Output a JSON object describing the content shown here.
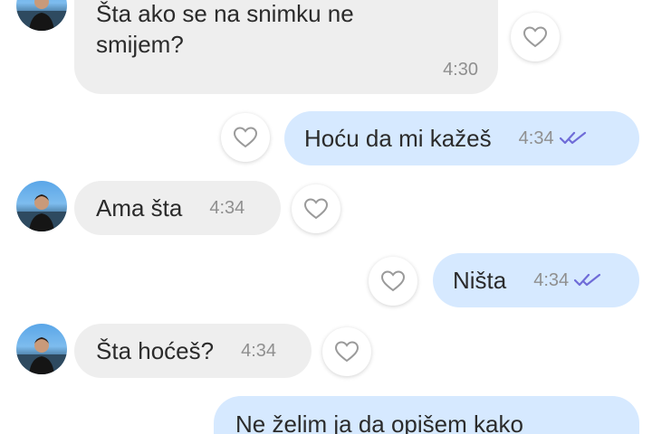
{
  "colors": {
    "incoming_bubble": "#eeeeee",
    "outgoing_bubble": "#d6e9ff",
    "timestamp": "#8f8f8f",
    "read_ticks": "#6f6cd8"
  },
  "messages": [
    {
      "direction": "incoming",
      "text": "Šta ako se na snimku ne smijem?",
      "line1": "Šta ako se na snimku ne",
      "line2": "smijem?",
      "time": "4:30",
      "icon": "heart-icon"
    },
    {
      "direction": "outgoing",
      "text": "Hoću da mi kažeš",
      "time": "4:34",
      "status": "read",
      "icon": "heart-icon"
    },
    {
      "direction": "incoming",
      "text": "Ama šta",
      "time": "4:34",
      "icon": "heart-icon"
    },
    {
      "direction": "outgoing",
      "text": "Ništa",
      "time": "4:34",
      "status": "read",
      "icon": "heart-icon"
    },
    {
      "direction": "incoming",
      "text": "Šta hoćeš?",
      "time": "4:34",
      "icon": "heart-icon"
    },
    {
      "direction": "outgoing",
      "text": "Ne želim ja da opišem kako"
    }
  ]
}
